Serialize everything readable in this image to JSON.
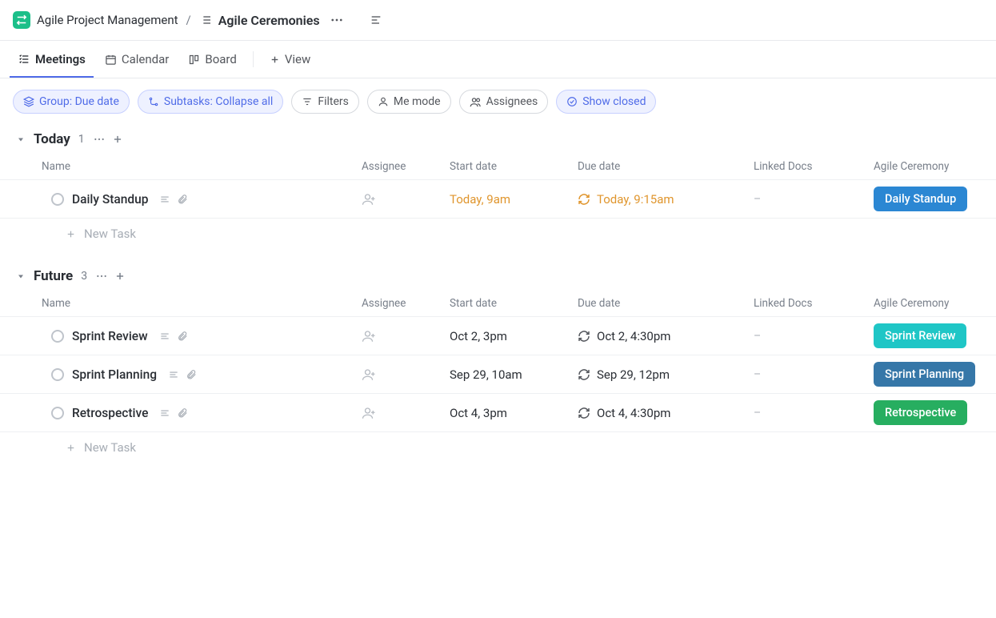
{
  "breadcrumb": {
    "project": "Agile Project Management",
    "page": "Agile Ceremonies"
  },
  "tabs": {
    "meetings": "Meetings",
    "calendar": "Calendar",
    "board": "Board",
    "addView": "View"
  },
  "filters": {
    "group": "Group: Due date",
    "subtasks": "Subtasks: Collapse all",
    "filters": "Filters",
    "me": "Me mode",
    "assignees": "Assignees",
    "closed": "Show closed"
  },
  "columns": {
    "name": "Name",
    "assignee": "Assignee",
    "start": "Start date",
    "due": "Due date",
    "docs": "Linked Docs",
    "ceremony": "Agile Ceremony"
  },
  "groups": [
    {
      "title": "Today",
      "count": "1",
      "tasks": [
        {
          "name": "Daily Standup",
          "start": "Today, 9am",
          "due": "Today, 9:15am",
          "dateClass": "date-orange",
          "recurClass": "orange",
          "tag": "Daily Standup",
          "tagColor": "tag-blue"
        }
      ]
    },
    {
      "title": "Future",
      "count": "3",
      "tasks": [
        {
          "name": "Sprint Review",
          "start": "Oct 2, 3pm",
          "due": "Oct 2, 4:30pm",
          "dateClass": "",
          "recurClass": "",
          "tag": "Sprint Review",
          "tagColor": "tag-teal"
        },
        {
          "name": "Sprint Planning",
          "start": "Sep 29, 10am",
          "due": "Sep 29, 12pm",
          "dateClass": "",
          "recurClass": "",
          "tag": "Sprint Planning",
          "tagColor": "tag-navy"
        },
        {
          "name": "Retrospective",
          "start": "Oct 4, 3pm",
          "due": "Oct 4, 4:30pm",
          "dateClass": "",
          "recurClass": "",
          "tag": "Retrospective",
          "tagColor": "tag-green"
        }
      ]
    }
  ],
  "misc": {
    "newTask": "New Task",
    "dash": "–"
  }
}
